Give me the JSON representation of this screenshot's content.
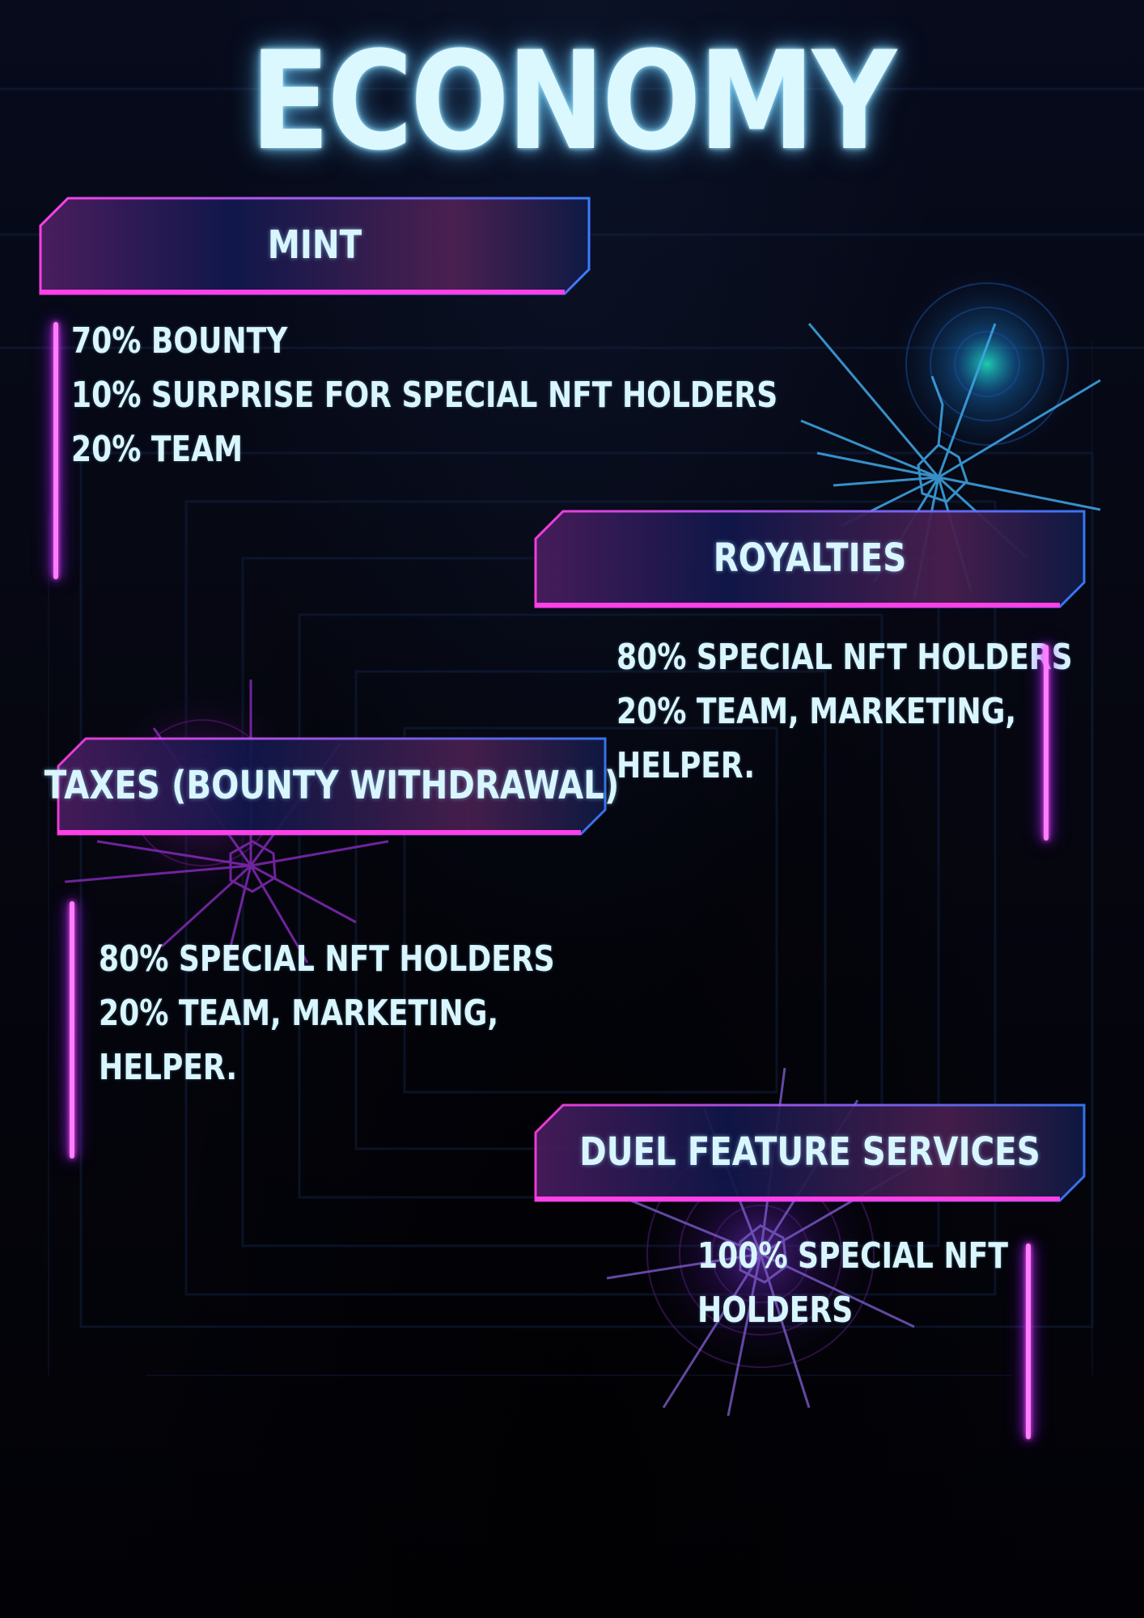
{
  "title": "ECONOMY",
  "colors": {
    "glow_cyan": "#dcf8ff",
    "accent_magenta": "#ff3fe8",
    "accent_blue": "#3a7bff",
    "banner_fill_start": "#4a1d5e",
    "banner_fill_end": "#0f1a45",
    "line_glow": "#ff7dff"
  },
  "sections": {
    "mint": {
      "heading": "MINT",
      "items": [
        "70% BOUNTY",
        "10% SURPRISE FOR SPECIAL NFT HOLDERS",
        "20% TEAM"
      ]
    },
    "royalties": {
      "heading": "ROYALTIES",
      "items": [
        "80% SPECIAL NFT HOLDERS",
        "20% TEAM, MARKETING,",
        "HELPER."
      ]
    },
    "taxes": {
      "heading": "TAXES (BOUNTY WITHDRAWAL)",
      "items": [
        "80% SPECIAL NFT HOLDERS",
        "20% TEAM, MARKETING,",
        "HELPER."
      ]
    },
    "duel": {
      "heading": "DUEL FEATURE SERVICES",
      "items": [
        "100% SPECIAL NFT",
        "HOLDERS"
      ]
    }
  },
  "decorations": [
    "shattered-glass-icon-cyan",
    "shattered-glass-icon-magenta",
    "shattered-glass-icon-violet"
  ]
}
